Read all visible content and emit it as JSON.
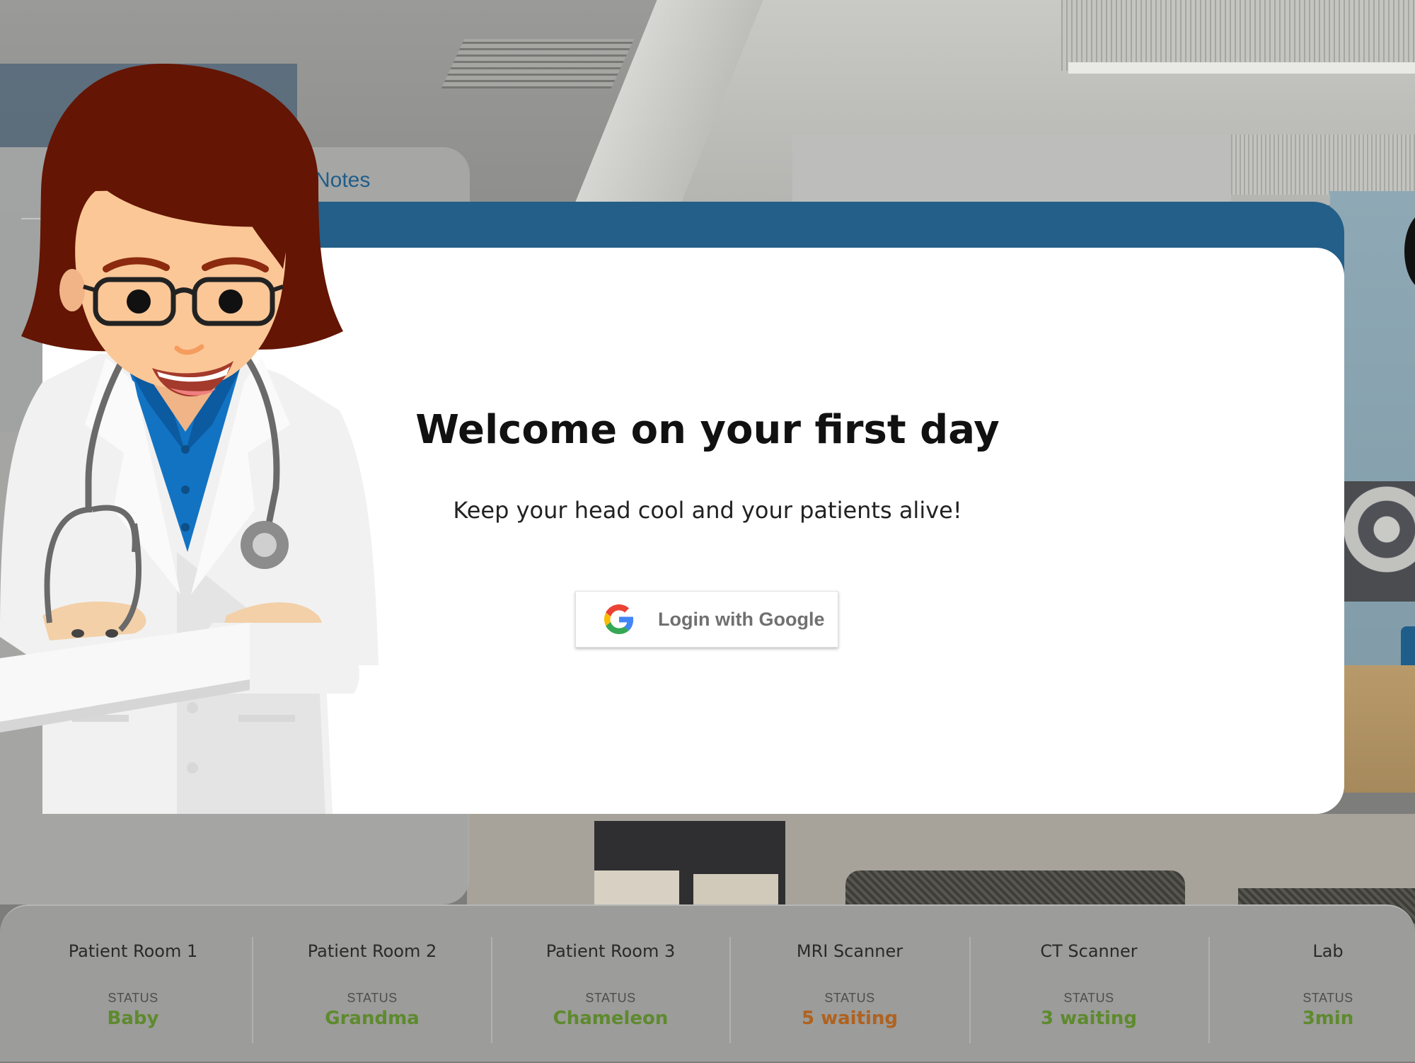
{
  "notes": {
    "tab_label": "Notes"
  },
  "dialog": {
    "title": "Welcome on your first day",
    "subtitle": "Keep your head cool and your patients alive!",
    "login_button_label": "Login with Google"
  },
  "status_bar": {
    "rooms": [
      {
        "name": "Patient Room 1",
        "status_label": "STATUS",
        "status_value": "Baby",
        "status_color": "#5e8a2e"
      },
      {
        "name": "Patient Room 2",
        "status_label": "STATUS",
        "status_value": "Grandma",
        "status_color": "#5e8a2e"
      },
      {
        "name": "Patient Room 3",
        "status_label": "STATUS",
        "status_value": "Chameleon",
        "status_color": "#5e8a2e"
      },
      {
        "name": "MRI Scanner",
        "status_label": "STATUS",
        "status_value": "5 waiting",
        "status_color": "#b0621f"
      },
      {
        "name": "CT Scanner",
        "status_label": "STATUS",
        "status_value": "3 waiting",
        "status_color": "#5e8a2e"
      },
      {
        "name": "Lab",
        "status_label": "STATUS",
        "status_value": "3min",
        "status_color": "#5e8a2e"
      }
    ]
  },
  "colors": {
    "dialog_header": "#235f88",
    "status_ok": "#5e8a2e",
    "status_warning": "#b0621f"
  },
  "icons": {
    "login": "google-icon",
    "character": "doctor-character"
  }
}
